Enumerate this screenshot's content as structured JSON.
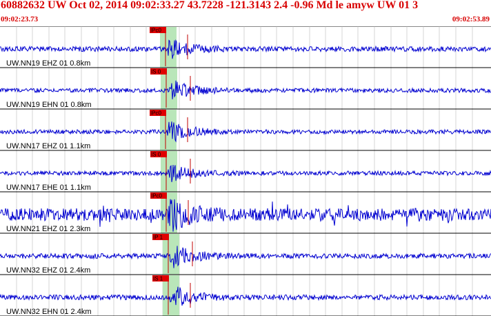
{
  "header": {
    "event_line": "60882632 UW Oct 02, 2014 09:02:33.27   43.7228 -121.3143  2.4 -0.96 Md le amyw UW 01   3",
    "start_time": "09:02:23.73",
    "end_time": "09:02:53.89"
  },
  "colors": {
    "header_text": "#d80000",
    "waveform": "#0000d0",
    "pick_box": "#e00000",
    "pick_line": "#c00000",
    "window_shade": "#b9e6b9",
    "grid": "#aaaaaa"
  },
  "channels": [
    {
      "label": "UW.NN19 EHZ 01 0.8km",
      "pick": "IPc0",
      "amplitude": 0.55,
      "noise": 0.12,
      "event_seed": 1
    },
    {
      "label": "UW.NN19 EHN 01 0.8km",
      "pick": "IS 0",
      "amplitude": 0.6,
      "noise": 0.1,
      "event_seed": 2
    },
    {
      "label": "UW.NN17 EHZ 01 1.1km",
      "pick": "IPc0",
      "amplitude": 0.6,
      "noise": 0.1,
      "event_seed": 3
    },
    {
      "label": "UW.NN17 EHE 01 1.1km",
      "pick": "IS 0",
      "amplitude": 0.5,
      "noise": 0.1,
      "event_seed": 4
    },
    {
      "label": "UW.NN21 EHZ 01 2.3km",
      "pick": "IPc0",
      "amplitude": 0.7,
      "noise": 0.3,
      "event_seed": 5
    },
    {
      "label": "UW.NN32 EHZ 01 2.4km",
      "pick": "IP 1",
      "amplitude": 0.6,
      "noise": 0.12,
      "event_seed": 6
    },
    {
      "label": "UW.NN32 EHN 01 2.4km",
      "pick": "IS 1",
      "amplitude": 0.65,
      "noise": 0.12,
      "event_seed": 7
    }
  ]
}
